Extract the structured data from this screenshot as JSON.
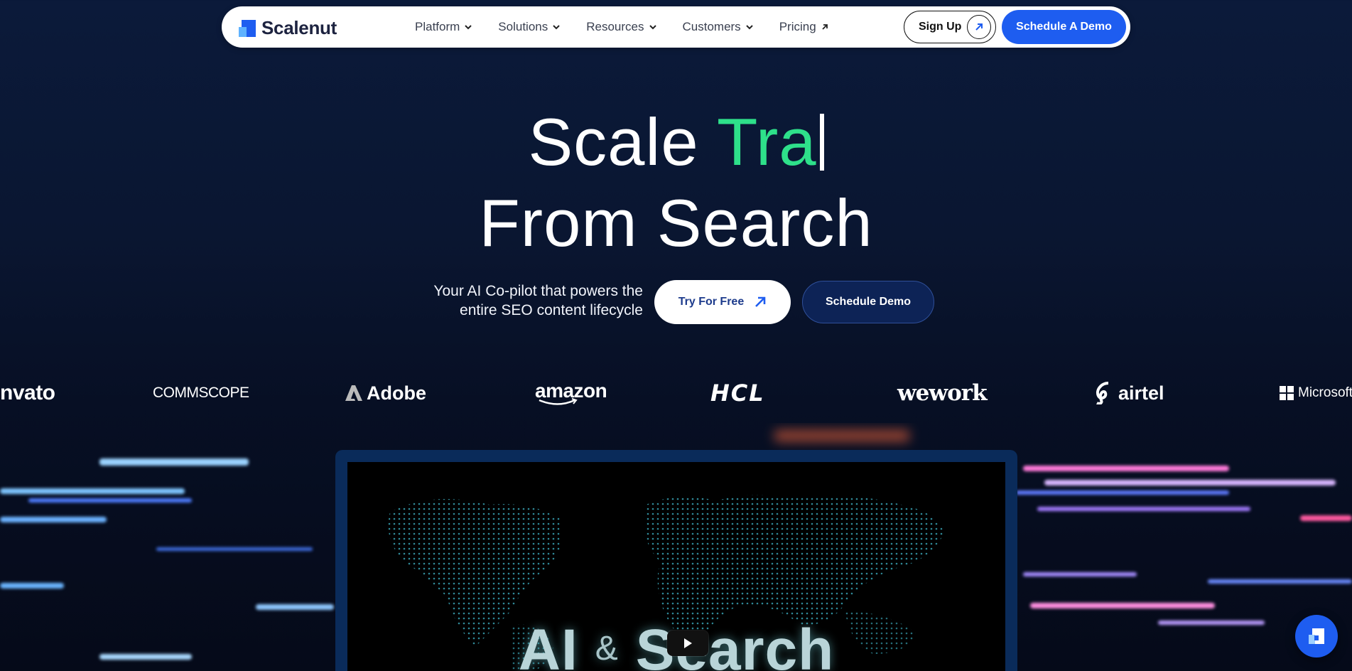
{
  "brand": {
    "name": "Scalenut",
    "primary_color": "#1e5df0",
    "accent_color": "#2ee08a"
  },
  "nav": {
    "items": [
      {
        "label": "Platform",
        "icon": "chevron-down-icon"
      },
      {
        "label": "Solutions",
        "icon": "chevron-down-icon"
      },
      {
        "label": "Resources",
        "icon": "chevron-down-icon"
      },
      {
        "label": "Customers",
        "icon": "chevron-down-icon"
      },
      {
        "label": "Pricing",
        "icon": "arrow-up-right-icon"
      }
    ],
    "signup_label": "Sign Up",
    "demo_label": "Schedule A Demo"
  },
  "hero": {
    "title_prefix": "Scale ",
    "title_typed": "Tra",
    "title_line2": "From Search",
    "tagline_line1": "Your AI Co-pilot that powers the",
    "tagline_line2": "entire SEO content lifecycle",
    "try_label": "Try For Free",
    "schedule_label": "Schedule Demo"
  },
  "logos": [
    "nvato",
    "COMMSCOPE",
    "Adobe",
    "amazon",
    "HCL",
    "wework",
    "airtel",
    "Microsoft"
  ],
  "video": {
    "title_left": "AI",
    "title_amp": "&",
    "title_right": "Search"
  }
}
